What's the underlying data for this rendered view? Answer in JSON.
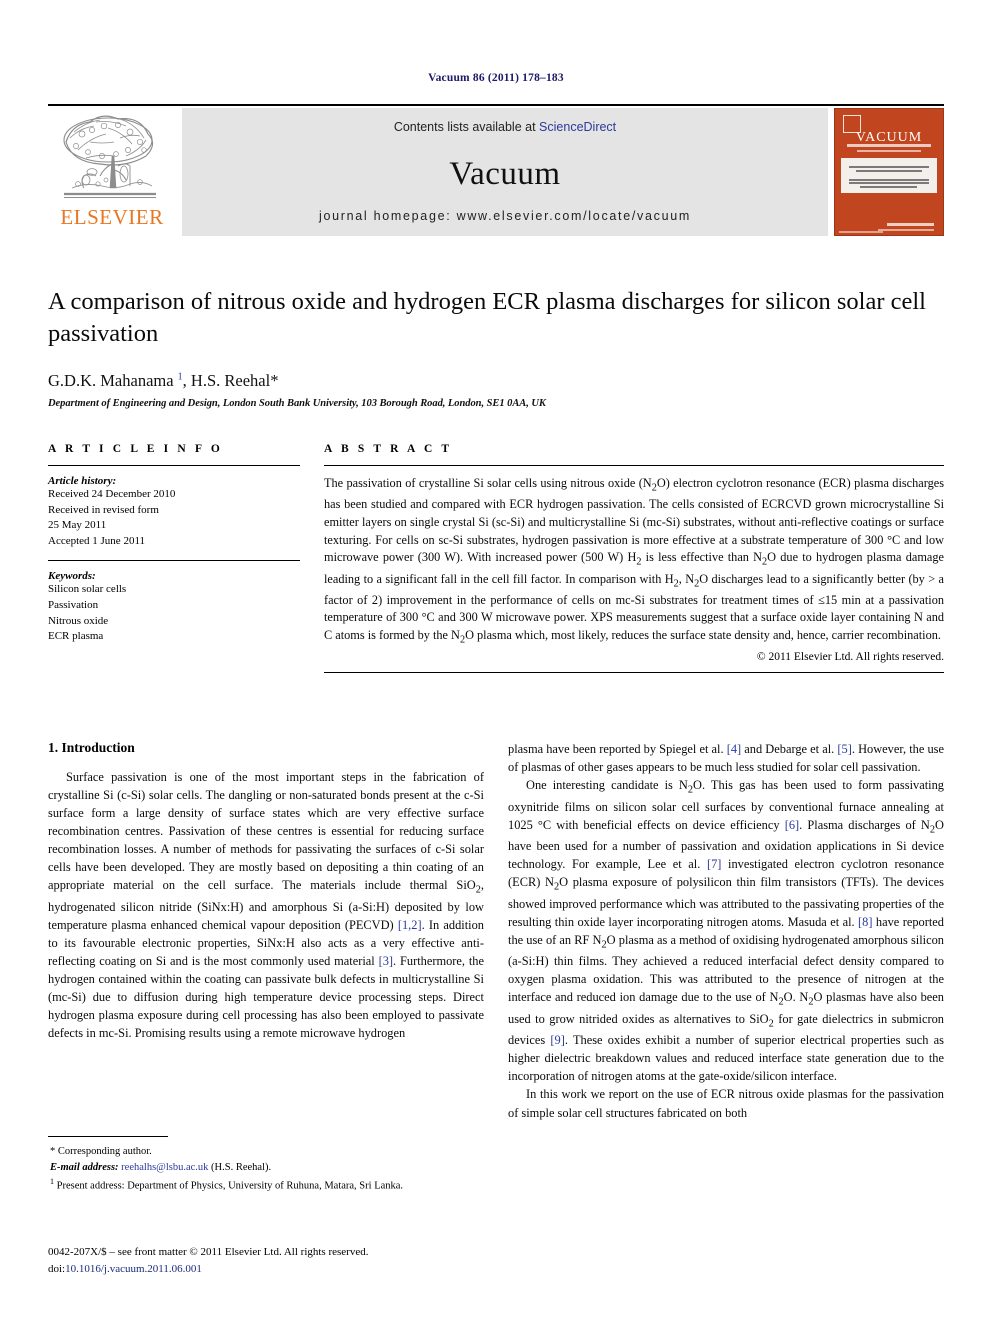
{
  "running_head": "Vacuum 86 (2011) 178–183",
  "masthead": {
    "publisher_wordmark": "ELSEVIER",
    "contents_prefix": "Contents lists available at",
    "contents_link": "ScienceDirect",
    "journal_name": "Vacuum",
    "homepage": "journal homepage: www.elsevier.com/locate/vacuum",
    "cover_title": "VACUUM",
    "accent_orange": "#e87722",
    "cover_orange": "#c1451f",
    "link_blue": "#2b3a9c",
    "panel_gray": "#e4e4e4"
  },
  "article": {
    "title": "A comparison of nitrous oxide and hydrogen ECR plasma discharges for silicon solar cell passivation",
    "authors_html": "G.D.K. Mahanama <sup>1</sup>, H.S. Reehal<span class=\"star\">*</span>",
    "affiliation": "Department of Engineering and Design, London South Bank University, 103 Borough Road, London, SE1 0AA, UK"
  },
  "info": {
    "heading": "A R T I C L E   I N F O",
    "history_label": "Article history:",
    "history": [
      "Received 24 December 2010",
      "Received in revised form",
      "25 May 2011",
      "Accepted 1 June 2011"
    ],
    "keywords_label": "Keywords:",
    "keywords": [
      "Silicon solar cells",
      "Passivation",
      "Nitrous oxide",
      "ECR plasma"
    ]
  },
  "abstract": {
    "heading": "A B S T R A C T",
    "body_html": "The passivation of crystalline Si solar cells using nitrous oxide (N<sub>2</sub>O) electron cyclotron resonance (ECR) plasma discharges has been studied and compared with ECR hydrogen passivation. The cells consisted of ECRCVD grown microcrystalline Si emitter layers on single crystal Si (sc-Si) and multicrystalline Si (mc-Si) substrates, without anti-reflective coatings or surface texturing. For cells on sc-Si substrates, hydrogen passivation is more effective at a substrate temperature of 300 °C and low microwave power (300 W). With increased power (500 W) H<sub>2</sub> is less effective than N<sub>2</sub>O due to hydrogen plasma damage leading to a significant fall in the cell fill factor. In comparison with H<sub>2</sub>, N<sub>2</sub>O discharges lead to a significantly better (by &gt; a factor of 2) improvement in the performance of cells on mc-Si substrates for treatment times of ≤15 min at a passivation temperature of 300 °C and 300 W microwave power. XPS measurements suggest that a surface oxide layer containing N and C atoms is formed by the N<sub>2</sub>O plasma which, most likely, reduces the surface state density and, hence, carrier recombination.",
    "copyright": "© 2011 Elsevier Ltd. All rights reserved."
  },
  "body": {
    "section_number_title": "1. Introduction",
    "left_paragraphs_html": [
      "Surface passivation is one of the most important steps in the fabrication of crystalline Si (c-Si) solar cells. The dangling or non-saturated bonds present at the c-Si surface form a large density of surface states which are very effective surface recombination centres. Passivation of these centres is essential for reducing surface recombination losses. A number of methods for passivating the surfaces of c-Si solar cells have been developed. They are mostly based on depositing a thin coating of an appropriate material on the cell surface. The materials include thermal SiO<sub>2</sub>, hydrogenated silicon nitride (SiNx:H) and amorphous Si (a-Si:H) deposited by low temperature plasma enhanced chemical vapour deposition (PECVD) <span class=\"ref\">[1,2]</span>. In addition to its favourable electronic properties, SiNx:H also acts as a very effective anti-reflecting coating on Si and is the most commonly used material <span class=\"ref\">[3]</span>. Furthermore, the hydrogen contained within the coating can passivate bulk defects in multicrystalline Si (mc-Si) due to diffusion during high temperature device processing steps. Direct hydrogen plasma exposure during cell processing has also been employed to passivate defects in mc-Si. Promising results using a remote microwave hydrogen"
    ],
    "right_paragraphs_html": [
      "plasma have been reported by Spiegel et al. <span class=\"ref\">[4]</span> and Debarge et al. <span class=\"ref\">[5]</span>. However, the use of plasmas of other gases appears to be much less studied for solar cell passivation.",
      "One interesting candidate is N<sub>2</sub>O. This gas has been used to form passivating oxynitride films on silicon solar cell surfaces by conventional furnace annealing at 1025 °C with beneficial effects on device efficiency <span class=\"ref\">[6]</span>. Plasma discharges of N<sub>2</sub>O have been used for a number of passivation and oxidation applications in Si device technology. For example, Lee et al. <span class=\"ref\">[7]</span> investigated electron cyclotron resonance (ECR) N<sub>2</sub>O plasma exposure of polysilicon thin film transistors (TFTs). The devices showed improved performance which was attributed to the passivating properties of the resulting thin oxide layer incorporating nitrogen atoms. Masuda et al. <span class=\"ref\">[8]</span> have reported the use of an RF N<sub>2</sub>O plasma as a method of oxidising hydrogenated amorphous silicon (a-Si:H) thin films. They achieved a reduced interfacial defect density compared to oxygen plasma oxidation. This was attributed to the presence of nitrogen at the interface and reduced ion damage due to the use of N<sub>2</sub>O. N<sub>2</sub>O plasmas have also been used to grow nitrided oxides as alternatives to SiO<sub>2</sub> for gate dielectrics in submicron devices <span class=\"ref\">[9]</span>. These oxides exhibit a number of superior electrical properties such as higher dielectric breakdown values and reduced interface state generation due to the incorporation of nitrogen atoms at the gate-oxide/silicon interface.",
      "In this work we report on the use of ECR nitrous oxide plasmas for the passivation of simple solar cell structures fabricated on both"
    ]
  },
  "footnotes": {
    "corresponding": "* Corresponding author.",
    "email_label": "E-mail address:",
    "email": "reehalhs@lsbu.ac.uk",
    "email_suffix": "(H.S. Reehal).",
    "present_address_marker": "1",
    "present_address": "Present address: Department of Physics, University of Ruhuna, Matara, Sri Lanka."
  },
  "imprint": {
    "issn_line": "0042-207X/$ – see front matter © 2011 Elsevier Ltd. All rights reserved.",
    "doi_prefix": "doi:",
    "doi": "10.1016/j.vacuum.2011.06.001"
  }
}
